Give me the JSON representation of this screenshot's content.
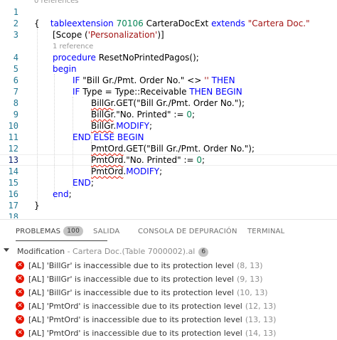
{
  "editor": {
    "code_lens": {
      "top": "0 references",
      "proc": "1 reference"
    },
    "line_numbers": [
      "1",
      "2",
      "3",
      "4",
      "5",
      "6",
      "7",
      "8",
      "9",
      "10",
      "11",
      "12",
      "13",
      "14",
      "15",
      "16",
      "17",
      "18"
    ],
    "lines": {
      "l1": {
        "kw1": "tableextension",
        "num": "70106",
        "name": "CarteraDocExt",
        "kw2": "extends",
        "str": "\"Cartera Doc.\""
      },
      "l2": {
        "text": "{"
      },
      "l3": {
        "open": "[Scope (",
        "str": "'Personalization'",
        "close": ")]"
      },
      "l5": {
        "kw": "procedure",
        "name": "ResetNoPrintedPagos();"
      },
      "l6": {
        "kw": "begin"
      },
      "l7": {
        "kw1": "IF",
        "str1": "\"Bill Gr./Pmt. Order No.\"",
        "op": "<>",
        "str2": "''",
        "kw2": "THEN"
      },
      "l8": {
        "kw1": "IF",
        "a": "Type",
        "eq": "=",
        "b": "Type",
        "c": "::Receivable",
        "kw2": "THEN BEGIN"
      },
      "l9": {
        "var": "BillGr",
        "rest": ".GET(\"Bill Gr./Pmt. Order No.\");"
      },
      "l10": {
        "var": "BillGr",
        "str": ".\"No. Printed\"",
        "op": ":=",
        "num": "0",
        "end": ";"
      },
      "l11": {
        "var": "BillGr",
        "dot": ".",
        "kw": "MODIFY",
        "end": ";"
      },
      "l12": {
        "kw": "END ELSE BEGIN"
      },
      "l13": {
        "var": "PmtOrd",
        "rest": ".GET(\"Bill Gr./Pmt. Order No.\");"
      },
      "l14": {
        "var": "PmtOrd",
        "str": ".\"No. Printed\"",
        "op": ":=",
        "num": "0",
        "end": ";"
      },
      "l15": {
        "var": "PmtOrd",
        "dot": ".",
        "kw": "MODIFY",
        "end": ";"
      },
      "l16": {
        "kw": "END",
        "end": ";"
      },
      "l17": {
        "kw": "end",
        "end": ";"
      },
      "l18": {
        "text": "}"
      }
    }
  },
  "panel": {
    "tabs": [
      {
        "label": "PROBLEMAS",
        "badge": "100"
      },
      {
        "label": "SALIDA"
      },
      {
        "label": "CONSOLA DE DEPURACIÓN"
      },
      {
        "label": "TERMINAL"
      }
    ],
    "group": {
      "label": "Modification",
      "path": "- Cartera Doc.(Table 7000002).al",
      "count": "6"
    },
    "problems": [
      {
        "icon": "error-icon",
        "message": "[AL] 'BillGr' is inaccessible due to its protection level",
        "location": "(8, 13)"
      },
      {
        "icon": "error-icon",
        "message": "[AL] 'BillGr' is inaccessible due to its protection level",
        "location": "(9, 13)"
      },
      {
        "icon": "error-icon",
        "message": "[AL] 'BillGr' is inaccessible due to its protection level",
        "location": "(10, 13)"
      },
      {
        "icon": "error-icon",
        "message": "[AL] 'PmtOrd' is inaccessible due to its protection level",
        "location": "(12, 13)"
      },
      {
        "icon": "error-icon",
        "message": "[AL] 'PmtOrd' is inaccessible due to its protection level",
        "location": "(13, 13)"
      },
      {
        "icon": "error-icon",
        "message": "[AL] 'PmtOrd' is inaccessible due to its protection level",
        "location": "(14, 13)"
      }
    ]
  },
  "colors": {
    "keyword": "#0000ff",
    "string": "#a31515",
    "number": "#098658",
    "line_number": "#237893",
    "error": "#e51400"
  }
}
